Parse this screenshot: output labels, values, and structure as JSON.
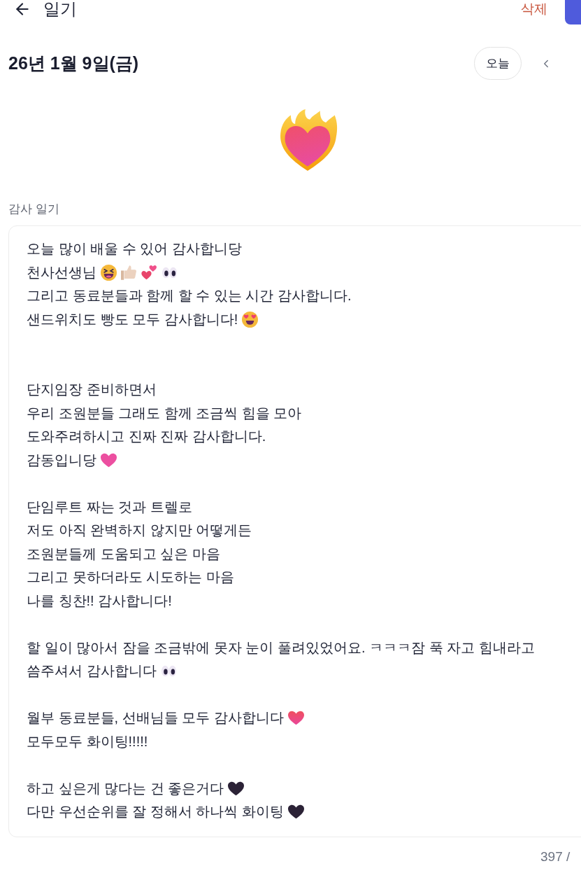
{
  "header": {
    "title": "일기",
    "delete_label": "삭제"
  },
  "date_bar": {
    "date": "26년 1월 9일(금)",
    "today_button": "오늘"
  },
  "mood": {
    "kind": "heart-on-fire"
  },
  "entry": {
    "label": "감사 일기",
    "lines": [
      {
        "kind": "text",
        "text": "오늘 많이 배울 수 있어 감사합니당"
      },
      {
        "kind": "text",
        "text": "천사선생님",
        "emojis": [
          {
            "kind": "laughing"
          },
          {
            "kind": "thumbs-up"
          },
          {
            "kind": "two-hearts"
          },
          {
            "kind": "eyes"
          }
        ]
      },
      {
        "kind": "text",
        "text": "그리고 동료분들과 함께 할 수 있는 시간 감사합니다."
      },
      {
        "kind": "text",
        "text": "샌드위치도 빵도 모두 감사합니다!",
        "emojis": [
          {
            "kind": "heart-eyes"
          }
        ]
      },
      {
        "kind": "blank"
      },
      {
        "kind": "blank"
      },
      {
        "kind": "text",
        "text": "단지임장 준비하면서"
      },
      {
        "kind": "text",
        "text": "우리 조원분들 그래도 함께 조금씩 힘을 모아"
      },
      {
        "kind": "text",
        "text": "도와주려하시고 진짜 진짜 감사합니다."
      },
      {
        "kind": "text",
        "text": "감동입니당",
        "emojis": [
          {
            "kind": "pink-heart"
          }
        ]
      },
      {
        "kind": "blank"
      },
      {
        "kind": "text",
        "text": "단임루트 짜는 것과 트렐로"
      },
      {
        "kind": "text",
        "text": "저도 아직 완벽하지 않지만 어떻게든"
      },
      {
        "kind": "text",
        "text": "조원분들께 도움되고 싶은 마음"
      },
      {
        "kind": "text",
        "text": "그리고 못하더라도 시도하는 마음"
      },
      {
        "kind": "text",
        "text": "나를 칭찬!! 감사합니다!"
      },
      {
        "kind": "blank"
      },
      {
        "kind": "text",
        "text": "할 일이 많아서 잠을 조금밖에 못자 눈이 풀려있었어요. ㅋㅋㅋ잠 푹 자고 힘내라고"
      },
      {
        "kind": "text",
        "text": "씀주셔서 감사합니다",
        "emojis": [
          {
            "kind": "eyes"
          }
        ]
      },
      {
        "kind": "blank"
      },
      {
        "kind": "text",
        "text": "월부 동료분들, 선배님들 모두 감사합니다",
        "emojis": [
          {
            "kind": "red-heart"
          }
        ]
      },
      {
        "kind": "text",
        "text": "모두모두 화이팅!!!!!"
      },
      {
        "kind": "blank"
      },
      {
        "kind": "text",
        "text": "하고 싶은게 많다는 건 좋은거다",
        "emojis": [
          {
            "kind": "dark-heart"
          }
        ]
      },
      {
        "kind": "text",
        "text": "다만 우선순위를 잘 정해서 하나씩 화이팅",
        "emojis": [
          {
            "kind": "dark-heart"
          }
        ]
      }
    ],
    "counter": "397 /"
  }
}
